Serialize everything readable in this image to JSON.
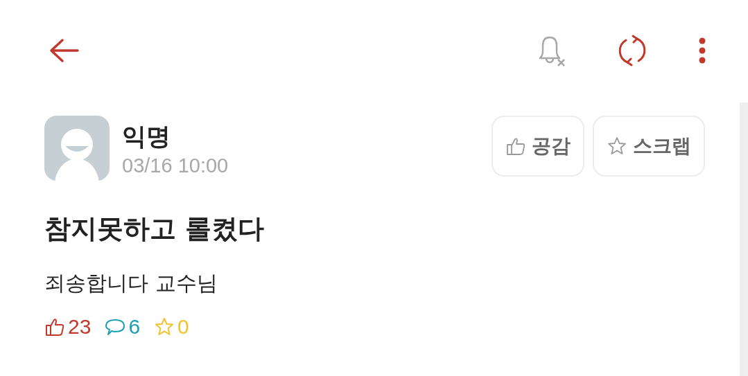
{
  "post": {
    "author": "익명",
    "time": "03/16 10:00",
    "title": "참지못하고 롤켰다",
    "body": "죄송합니다 교수님"
  },
  "actions": [
    {
      "kind": "like",
      "label": "공감"
    },
    {
      "kind": "scrap",
      "label": "스크랩"
    }
  ],
  "stats": [
    {
      "kind": "like",
      "count": "23",
      "color": "#c0392b"
    },
    {
      "kind": "comment",
      "count": "6",
      "color": "#1aa0b0"
    },
    {
      "kind": "scrap",
      "count": "0",
      "color": "#f2c230"
    }
  ]
}
